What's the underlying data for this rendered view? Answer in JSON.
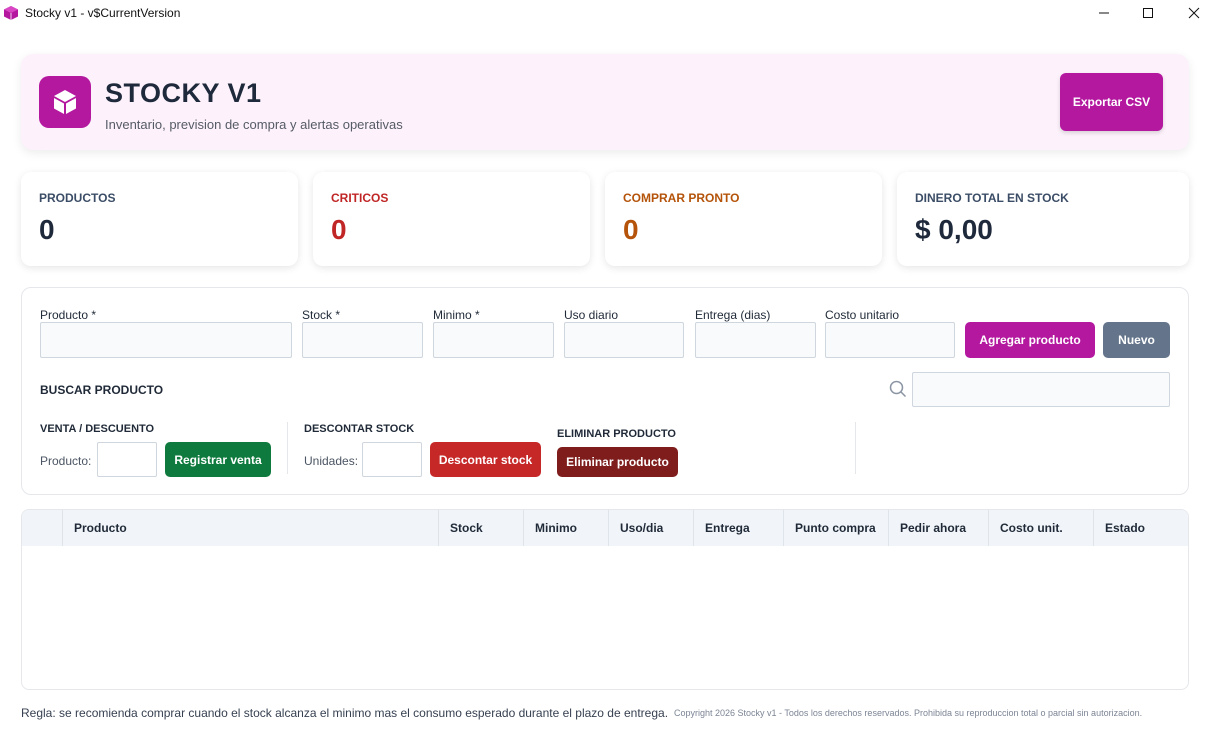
{
  "window": {
    "title": "Stocky v1 - v$CurrentVersion"
  },
  "header": {
    "app_name": "STOCKY V1",
    "subtitle": "Inventario, prevision de compra y alertas operativas",
    "export_label": "Exportar CSV"
  },
  "stats": [
    {
      "label": "PRODUCTOS",
      "value": "0",
      "color": "#3b4d66"
    },
    {
      "label": "CRITICOS",
      "value": "0",
      "color": "#c02626"
    },
    {
      "label": "COMPRAR PRONTO",
      "value": "0",
      "color": "#b45309"
    },
    {
      "label": "DINERO TOTAL EN STOCK",
      "value": "$ 0,00",
      "color": "#3b4d66"
    }
  ],
  "form": {
    "producto_label": "Producto *",
    "stock_label": "Stock *",
    "minimo_label": "Minimo *",
    "uso_label": "Uso diario",
    "entrega_label": "Entrega (dias)",
    "costo_label": "Costo unitario",
    "add_label": "Agregar producto",
    "new_label": "Nuevo",
    "search_label": "BUSCAR PRODUCTO",
    "venta_title": "VENTA / DESCUENTO",
    "venta_field_label": "Producto:",
    "venta_button": "Registrar venta",
    "descontar_title": "DESCONTAR STOCK",
    "descontar_field_label": "Unidades:",
    "descontar_button": "Descontar stock",
    "eliminar_title": "ELIMINAR PRODUCTO",
    "eliminar_button": "Eliminar producto"
  },
  "table": {
    "columns": [
      "Producto",
      "Stock",
      "Minimo",
      "Uso/dia",
      "Entrega",
      "Punto compra",
      "Pedir ahora",
      "Costo unit.",
      "Estado"
    ],
    "rows": []
  },
  "footer": {
    "rule": "Regla: se recomienda comprar cuando el stock alcanza el minimo mas el consumo esperado durante el plazo de entrega.",
    "copyright": "Copyright 2026 Stocky v1 - Todos los derechos reservados. Prohibida su reproduccion total o parcial sin autorizacion."
  },
  "colors": {
    "brand": "#b3189f",
    "success": "#0f7a3e",
    "danger": "#c62828",
    "danger_dark": "#7f1d1d",
    "neutral": "#64748b"
  },
  "icons": [
    "app-cube-icon",
    "minimize-icon",
    "maximize-icon",
    "close-icon",
    "cube-logo-icon",
    "search-icon"
  ]
}
